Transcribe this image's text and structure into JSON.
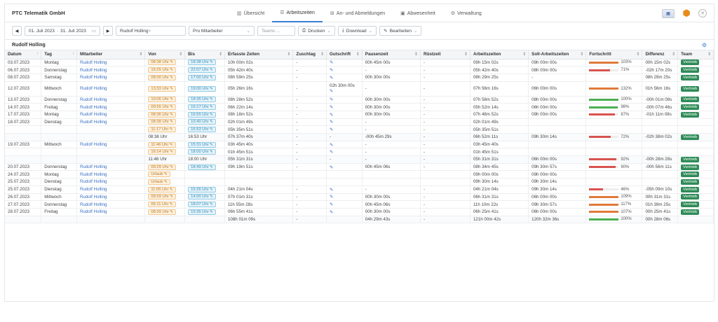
{
  "app": {
    "title": "PTC Telematik GmbH"
  },
  "nav": [
    {
      "label": "Übersicht",
      "icon": "chart-icon",
      "active": false
    },
    {
      "label": "Arbeitszeiten",
      "icon": "list-icon",
      "active": true
    },
    {
      "label": "An- und Abmeldungen",
      "icon": "login-icon",
      "active": false
    },
    {
      "label": "Abwesenheit",
      "icon": "calendar-icon",
      "active": false
    },
    {
      "label": "Verwaltung",
      "icon": "gear-icon",
      "active": false
    }
  ],
  "toolbar": {
    "date_from": "01. Juli 2023",
    "date_sep": "-",
    "date_to": "31. Juli 2023",
    "employee_chip": "Rudolf Holling",
    "grouping": "Pro Mitarbeiter",
    "teams_placeholder": "Teams ...",
    "print_label": "Drucken",
    "download_label": "Download",
    "edit_label": "Bearbeiten"
  },
  "section_title": "Rudolf Holling",
  "columns": [
    "Datum",
    "Tag",
    "Mitarbeiter",
    "Von",
    "Bis",
    "Erfasste Zeiten",
    "Zuschlag",
    "Gutschrift",
    "Pausenzeit",
    "Rüstzeit",
    "Arbeitszeiten",
    "Soll-Arbeitszeiten",
    "Fortschritt",
    "Differenz",
    "Team"
  ],
  "colors": {
    "accent": "#3b7dd8",
    "team_badge": "#2e8b57",
    "progress_over": "#e07a3a",
    "progress_ok": "#4caf50",
    "progress_under": "#d9534f"
  },
  "rows": [
    {
      "datum": "03.07.2023",
      "tag": "Montag",
      "mit": "Rudolf Holling",
      "von": "08:38 Uhr",
      "bis": "18:38 Uhr",
      "erf": "10h 00m 02s",
      "zus": "-",
      "gut": "pen",
      "pause": "00h 45m 00s",
      "ruest": "-",
      "arb": "09h 15m 02s",
      "soll": "09h 00m 00s",
      "prog": 1.03,
      "pct": "103%",
      "diff": "00h 15m 02s",
      "team": "Vertrieb"
    },
    {
      "datum": "06.07.2023",
      "tag": "Donnerstag",
      "mit": "Rudolf Holling",
      "von": "16:25 Uhr",
      "bis": "22:07 Uhr",
      "erf": "05h 42m 40s",
      "zus": "-",
      "gut": "pen",
      "pause": "-",
      "ruest": "-",
      "arb": "05h 42m 40s",
      "soll": "08h 00m 00s",
      "prog": 0.71,
      "pct": "71%",
      "diff": "-02h 17m 20s",
      "team": "Vertrieb"
    },
    {
      "datum": "08.07.2023",
      "tag": "Samstag",
      "mit": "Rudolf Holling",
      "von": "08:00 Uhr",
      "bis": "17:00 Uhr",
      "erf": "08h 59m 25s",
      "zus": "-",
      "gut": "pen",
      "pause": "00h 30m 00s",
      "ruest": "-",
      "arb": "08h 29m 25s",
      "soll": "-",
      "prog": null,
      "pct": "",
      "diff": "08h 29m 25s",
      "team": "Vertrieb"
    },
    {
      "datum": "12.07.2023",
      "tag": "Mittwoch",
      "mit": "Rudolf Holling",
      "von": "13:33 Uhr",
      "bis": "19:00 Uhr",
      "erf": "05h 26m 16s",
      "zus": "-",
      "gut": "02h 30m 00s",
      "pause": "-",
      "ruest": "-",
      "arb": "07h 56m 16s",
      "soll": "06h 00m 00s",
      "prog": 1.32,
      "pct": "132%",
      "diff": "01h 56m 16s",
      "team": "Vertrieb",
      "tall": true
    },
    {
      "datum": "13.07.2023",
      "tag": "Donnerstag",
      "mit": "Rudolf Holling",
      "von": "10:06 Uhr",
      "bis": "18:35 Uhr",
      "erf": "08h 28m 52s",
      "zus": "-",
      "gut": "pen",
      "pause": "00h 30m 00s",
      "ruest": "-",
      "arb": "07h 58m 52s",
      "soll": "08h 00m 00s",
      "prog": 1.0,
      "pct": "100%",
      "diff": "-00h 01m 08s",
      "team": "Vertrieb"
    },
    {
      "datum": "14.07.2023",
      "tag": "Freitag",
      "mit": "Rudolf Holling",
      "von": "09:55 Uhr",
      "bis": "16:17 Uhr",
      "erf": "06h 22m 14s",
      "zus": "-",
      "gut": "pen",
      "pause": "00h 30m 00s",
      "ruest": "-",
      "arb": "05h 52m 14s",
      "soll": "06h 00m 00s",
      "prog": 0.98,
      "pct": "98%",
      "diff": "-00h 07m 46s",
      "team": "Vertrieb"
    },
    {
      "datum": "17.07.2023",
      "tag": "Montag",
      "mit": "Rudolf Holling",
      "von": "08:36 Uhr",
      "bis": "16:55 Uhr",
      "erf": "08h 18m 52s",
      "zus": "-",
      "gut": "pen",
      "pause": "00h 30m 00s",
      "ruest": "-",
      "arb": "07h 48m 52s",
      "soll": "09h 00m 00s",
      "prog": 0.87,
      "pct": "87%",
      "diff": "-01h 11m 08s",
      "team": "Vertrieb"
    },
    {
      "datum": "18.07.2023",
      "tag": "Dienstag",
      "mit": "Rudolf Holling",
      "von": "08:38 Uhr",
      "bis": "10:40 Uhr",
      "erf": "02h 01m 49s",
      "zus": "-",
      "gut": "pen",
      "pause": "-",
      "ruest": "-",
      "arb": "02h 01m 49s",
      "soll": "",
      "prog": null,
      "pct": "",
      "diff": "",
      "team": "",
      "sep": true
    },
    {
      "datum": "",
      "tag": "",
      "mit": "",
      "von": "11:17 Uhr",
      "bis": "16:53 Uhr",
      "erf": "05h 35m 51s",
      "zus": "-",
      "gut": "pen",
      "pause": "-",
      "ruest": "-",
      "arb": "05h 35m 51s",
      "soll": "",
      "prog": null,
      "pct": "",
      "diff": "",
      "team": ""
    },
    {
      "datum": "",
      "tag": "",
      "mit": "",
      "von": "08:38 Uhr",
      "bis": "16:53 Uhr",
      "erf": "07h 37m 40s",
      "zus": "-",
      "gut": "-",
      "pause": "-00h 45m 29s",
      "ruest": "-",
      "arb": "06h 52m 11s",
      "soll": "09h 30m 14s",
      "prog": 0.72,
      "pct": "72%",
      "diff": "-02h 38m 02s",
      "team": "Vertrieb",
      "sum": true
    },
    {
      "datum": "19.07.2023",
      "tag": "Mittwoch",
      "mit": "Rudolf Holling",
      "von": "11:46 Uhr",
      "bis": "15:31 Uhr",
      "erf": "03h 45m 40s",
      "zus": "-",
      "gut": "pen",
      "pause": "-",
      "ruest": "-",
      "arb": "03h 45m 40s",
      "soll": "",
      "prog": null,
      "pct": "",
      "diff": "",
      "team": "",
      "sep": true
    },
    {
      "datum": "",
      "tag": "",
      "mit": "",
      "von": "16:14 Uhr",
      "bis": "18:00 Uhr",
      "erf": "01h 45m 51s",
      "zus": "-",
      "gut": "pen",
      "pause": "-",
      "ruest": "-",
      "arb": "01h 45m 51s",
      "soll": "",
      "prog": null,
      "pct": "",
      "diff": "",
      "team": ""
    },
    {
      "datum": "",
      "tag": "",
      "mit": "",
      "von": "11:46 Uhr",
      "bis": "18:00 Uhr",
      "erf": "05h 31m 31s",
      "zus": "-",
      "gut": "-",
      "pause": "-",
      "ruest": "-",
      "arb": "05h 31m 31s",
      "soll": "06h 00m 00s",
      "prog": 0.92,
      "pct": "92%",
      "diff": "-00h 28m 28s",
      "team": "Vertrieb",
      "sum": true
    },
    {
      "datum": "20.07.2023",
      "tag": "Donnerstag",
      "mit": "Rudolf Holling",
      "von": "09:29 Uhr",
      "bis": "18:49 Uhr",
      "erf": "09h 19m 51s",
      "zus": "-",
      "gut": "pen",
      "pause": "00h 45m 06s",
      "ruest": "-",
      "arb": "08h 34m 45s",
      "soll": "09h 30m 57s",
      "prog": 0.9,
      "pct": "90%",
      "diff": "-00h 56m 11s",
      "team": "Vertrieb",
      "sep": true
    },
    {
      "datum": "24.07.2023",
      "tag": "Montag",
      "mit": "Rudolf Holling",
      "von": "Urlaub",
      "bis": "",
      "erf": "",
      "zus": "",
      "gut": "",
      "pause": "",
      "ruest": "",
      "arb": "09h 00m 00s",
      "soll": "09h 00m 00s",
      "prog": null,
      "pct": "",
      "diff": "",
      "team": "Vertrieb"
    },
    {
      "datum": "25.07.2023",
      "tag": "Dienstag",
      "mit": "Rudolf Holling",
      "von": "Urlaub",
      "bis": "",
      "erf": "",
      "zus": "",
      "gut": "",
      "pause": "",
      "ruest": "",
      "arb": "09h 30m 14s",
      "soll": "09h 30m 14s",
      "prog": null,
      "pct": "",
      "diff": "",
      "team": "Vertrieb"
    },
    {
      "datum": "25.07.2023",
      "tag": "Dienstag",
      "mit": "Rudolf Holling",
      "von": "11:05 Uhr",
      "bis": "15:26 Uhr",
      "erf": "04h 21m 04s",
      "zus": "-",
      "gut": "pen",
      "pause": "-",
      "ruest": "-",
      "arb": "04h 21m 04s",
      "soll": "09h 30m 14s",
      "prog": 0.46,
      "pct": "46%",
      "diff": "-05h 09m 10s",
      "team": "Vertrieb"
    },
    {
      "datum": "26.07.2023",
      "tag": "Mittwoch",
      "mit": "Rudolf Holling",
      "von": "06:59 Uhr",
      "bis": "14:00 Uhr",
      "erf": "07h 01m 31s",
      "zus": "-",
      "gut": "pen",
      "pause": "00h 30m 00s",
      "ruest": "-",
      "arb": "06h 31m 31s",
      "soll": "06h 00m 00s",
      "prog": 1.09,
      "pct": "109%",
      "diff": "00h 31m 31s",
      "team": "Vertrieb"
    },
    {
      "datum": "27.07.2023",
      "tag": "Donnerstag",
      "mit": "Rudolf Holling",
      "von": "06:11 Uhr",
      "bis": "18:07 Uhr",
      "erf": "11h 55m 28s",
      "zus": "-",
      "gut": "pen",
      "pause": "00h 45m 06s",
      "ruest": "-",
      "arb": "11h 10m 22s",
      "soll": "09h 30m 57s",
      "prog": 1.17,
      "pct": "117%",
      "diff": "01h 39m 25s",
      "team": "Vertrieb"
    },
    {
      "datum": "28.07.2023",
      "tag": "Freitag",
      "mit": "Rudolf Holling",
      "von": "08:39 Uhr",
      "bis": "15:35 Uhr",
      "erf": "06h 55m 41s",
      "zus": "-",
      "gut": "pen",
      "pause": "00h 30m 00s",
      "ruest": "-",
      "arb": "06h 25m 41s",
      "soll": "06h 00m 00s",
      "prog": 1.07,
      "pct": "107%",
      "diff": "00h 25m 41s",
      "team": "Vertrieb"
    },
    {
      "datum": "",
      "tag": "",
      "mit": "",
      "von": "",
      "bis": "",
      "erf": "108h 01m 09s",
      "zus": "-",
      "gut": "",
      "pause": "04h 29m 43s",
      "ruest": "-",
      "arb": "121h 00m 42s",
      "soll": "120h 32m 36s",
      "prog": 1.0,
      "pct": "100%",
      "diff": "00h 28m 06s",
      "team": "",
      "sum": true
    }
  ]
}
